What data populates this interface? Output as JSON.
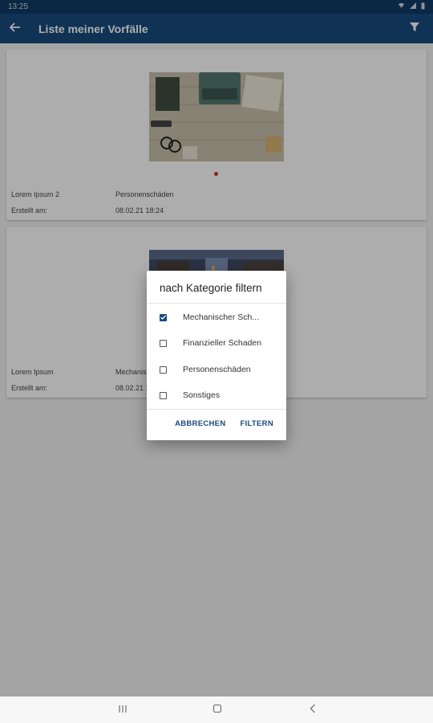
{
  "status_bar": {
    "time": "13:25"
  },
  "app_bar": {
    "title": "Liste meiner Vorfälle"
  },
  "cards": [
    {
      "title": "Lorem Ipsum 2",
      "category": "Personenschäden",
      "created_label": "Erstellt am:",
      "created_value": "08.02.21 18:24"
    },
    {
      "title": "Lorem Ipsum",
      "category": "Mechanischer Schaden",
      "created_label": "Erstellt am:",
      "created_value": "08.02.21 18:21"
    }
  ],
  "dialog": {
    "title": "nach Kategorie filtern",
    "options": [
      {
        "label": "Mechanischer Sch...",
        "checked": true
      },
      {
        "label": "Finanzieller Schaden",
        "checked": false
      },
      {
        "label": "Personenschäden",
        "checked": false
      },
      {
        "label": "Sonstiges",
        "checked": false
      }
    ],
    "cancel_label": "ABBRECHEN",
    "confirm_label": "FILTERN"
  },
  "colors": {
    "primary": "#174a7e",
    "status_bar": "#0f3a66",
    "accent_dot": "#d0312d"
  }
}
